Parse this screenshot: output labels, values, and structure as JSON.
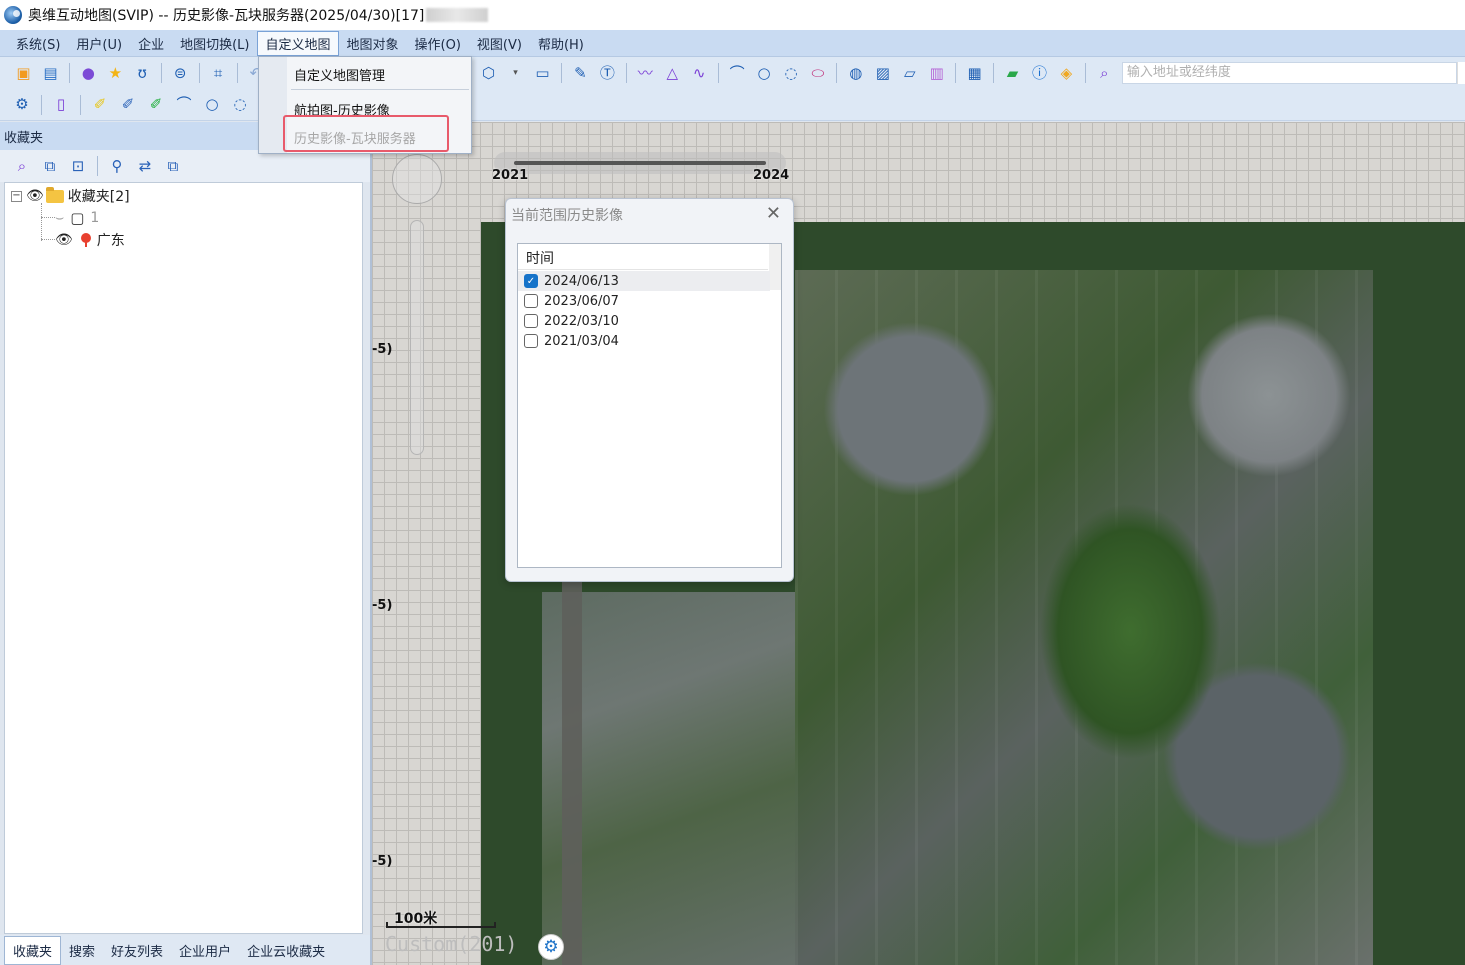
{
  "window": {
    "title": "奥维互动地图(SVIP) -- 历史影像-瓦块服务器(2025/04/30)[17]"
  },
  "menu": {
    "items": [
      {
        "label": "系统(S)"
      },
      {
        "label": "用户(U)"
      },
      {
        "label": "企业"
      },
      {
        "label": "地图切换(L)"
      },
      {
        "label": "自定义地图"
      },
      {
        "label": "地图对象"
      },
      {
        "label": "操作(O)"
      },
      {
        "label": "视图(V)"
      },
      {
        "label": "帮助(H)"
      }
    ],
    "active": "自定义地图"
  },
  "dropdown": {
    "items": [
      "自定义地图管理",
      "航拍图-历史影像",
      "历史影像-瓦块服务器"
    ]
  },
  "search": {
    "placeholder": "输入地址或经纬度"
  },
  "left_panel": {
    "header": "收藏夹",
    "tree": {
      "root": "收藏夹[2]",
      "child1": "1",
      "child2": "广东"
    },
    "tabs": [
      "收藏夹",
      "搜索",
      "好友列表",
      "企业用户",
      "企业云收藏夹"
    ]
  },
  "map": {
    "timebar": {
      "start": "2021",
      "end": "2024"
    },
    "ruler_labels": [
      "-5)",
      "-5)",
      "-5)"
    ],
    "scale": "100米",
    "custom": "Custom(201)"
  },
  "dialog": {
    "title": "当前范围历史影像",
    "header": "时间",
    "rows": [
      {
        "date": "2024/06/13",
        "checked": true
      },
      {
        "date": "2023/06/07",
        "checked": false
      },
      {
        "date": "2022/03/10",
        "checked": false
      },
      {
        "date": "2021/03/04",
        "checked": false
      }
    ]
  },
  "colors": {
    "accent": "#1673c9",
    "highlight": "#e85a6b",
    "menubar": "#c9dbf2"
  }
}
